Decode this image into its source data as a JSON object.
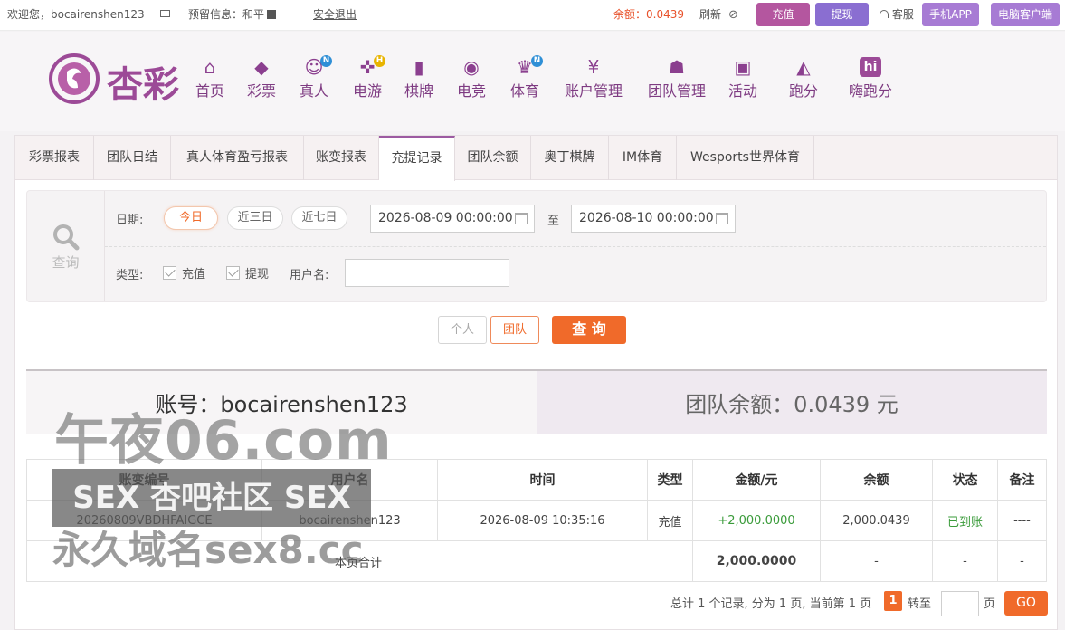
{
  "topbar": {
    "welcome": "欢迎您，bocairenshen123",
    "reserved": "预留信息：和平",
    "logout": "安全退出",
    "balance": "余额：0.0439",
    "refresh": "刷新",
    "deposit": "充值",
    "withdraw": "提现",
    "service": "客服",
    "mobile_app": "手机APP",
    "pc_client": "电脑客户端"
  },
  "colors": {
    "accent": "#f06a2a",
    "purple": "#9c5aa1",
    "deposit_btn": "#b4569f",
    "withdraw_btn": "#8a6ed1",
    "app_btn": "#a77bd4"
  },
  "logo": {
    "text": "杏彩"
  },
  "nav": [
    {
      "label": "首页",
      "icon": "home-icon"
    },
    {
      "label": "彩票",
      "icon": "lottery-icon"
    },
    {
      "label": "真人",
      "icon": "live-dealer-icon",
      "badge": "N"
    },
    {
      "label": "电游",
      "icon": "gamepad-icon",
      "badge": "H"
    },
    {
      "label": "棋牌",
      "icon": "cards-icon"
    },
    {
      "label": "电竞",
      "icon": "esports-icon"
    },
    {
      "label": "体育",
      "icon": "trophy-icon",
      "badge": "N"
    },
    {
      "label": "账户管理",
      "icon": "yen-icon"
    },
    {
      "label": "团队管理",
      "icon": "team-icon"
    },
    {
      "label": "活动",
      "icon": "gift-icon"
    },
    {
      "label": "跑分",
      "icon": "rhino-icon"
    },
    {
      "label": "嗨跑分",
      "icon": "hi-icon",
      "logo_text": "hi"
    }
  ],
  "tabs": [
    "彩票报表",
    "团队日结",
    "真人体育盈亏报表",
    "账变报表",
    "充提记录",
    "团队余额",
    "奥丁棋牌",
    "IM体育",
    "Wesports世界体育"
  ],
  "query": {
    "icon_label": "查询",
    "date_label": "日期:",
    "ranges": [
      "今日",
      "近三日",
      "近七日"
    ],
    "date_from": "2026-08-09 00:00:00",
    "to_label": "至",
    "date_to": "2026-08-10 00:00:00",
    "type_label": "类型:",
    "type_deposit": "充值",
    "type_withdraw": "提现",
    "username_label": "用户名:",
    "username_value": "",
    "personal": "个人",
    "team": "团队",
    "submit": "查 询"
  },
  "account": {
    "account_text": "账号：bocairenshen123",
    "team_balance": "团队余额：0.0439 元"
  },
  "table": {
    "headers": [
      "账变编号",
      "用户名",
      "时间",
      "类型",
      "金额/元",
      "余额",
      "状态",
      "备注"
    ],
    "rows": [
      {
        "id": "20260809VBDHFAIGCE",
        "user": "bocairenshen123",
        "time": "2026-08-09 10:35:16",
        "type": "充值",
        "amount": "+2,000.0000",
        "balance": "2,000.0439",
        "status": "已到账",
        "note": "----"
      }
    ],
    "summary": {
      "label": "本页合计",
      "amount": "2,000.0000",
      "balance": "-",
      "status": "-",
      "note": "-"
    }
  },
  "pager": {
    "summary": "总计 1 个记录, 分为 1 页, 当前第 1 页",
    "current": "1",
    "goto": "转至",
    "page_unit": "页",
    "go": "GO"
  },
  "watermark": {
    "line1": "午夜06.com",
    "line2": "SEX 杏吧社区 SEX",
    "line3": "永久域名sex8.cc"
  }
}
